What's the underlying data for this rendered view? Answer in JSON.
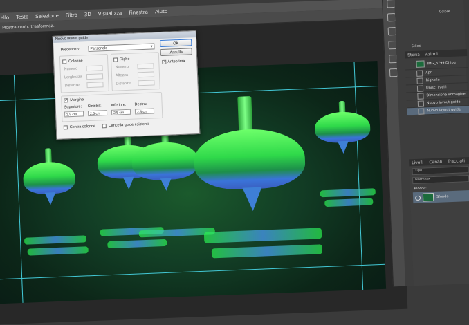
{
  "menubar": {
    "items": [
      "Livello",
      "Testo",
      "Selezione",
      "Filtro",
      "3D",
      "Visualizza",
      "Finestra",
      "Aiuto"
    ]
  },
  "options": {
    "show_transform": "Mostra contr. trasformaz."
  },
  "dialog": {
    "title": "Nuovo layout guide",
    "preset_label": "Predefinito:",
    "preset_value": "Personale",
    "ok": "OK",
    "cancel": "Annulla",
    "preview": "Anteprima",
    "columns": {
      "label": "Colonne",
      "number": "Numero",
      "width": "Larghezza",
      "gutter": "Distanze"
    },
    "rows": {
      "label": "Righe",
      "number": "Numero",
      "height": "Altezza",
      "gutter": "Distanze"
    },
    "margin": {
      "label": "Margine",
      "top_label": "Superiore:",
      "left_label": "Sinistra:",
      "bottom_label": "Inferiore:",
      "right_label": "Destra:",
      "top": "2,5 cm",
      "left": "2,5 cm",
      "bottom": "2,5 cm",
      "right": "2,5 cm"
    },
    "center_columns": "Centra colonne",
    "clear_existing": "Cancella guide esistenti"
  },
  "right": {
    "swatch_label": "Colore",
    "style_label": "Stiles",
    "history_tabs": [
      "Storia",
      "Azioni"
    ],
    "history_file": "IMG_8799 DJ.jpg",
    "history_items": [
      {
        "label": "Apri",
        "selected": false
      },
      {
        "label": "Righello",
        "selected": false
      },
      {
        "label": "Unisci livelli",
        "selected": false
      },
      {
        "label": "Dimensione immagine",
        "selected": false
      },
      {
        "label": "Nuovo layout guide",
        "selected": false
      },
      {
        "label": "Nuovo layout guide",
        "selected": true
      }
    ],
    "layers_tabs": [
      "Livelli",
      "Canali",
      "Tracciati"
    ],
    "filter_placeholder": "Tipo",
    "blend_mode": "Normale",
    "lock_label": "Blocca:",
    "layer_name": "Sfondo"
  },
  "colors": {
    "guide": "#43c8d6",
    "selected_row": "#596a7c"
  }
}
